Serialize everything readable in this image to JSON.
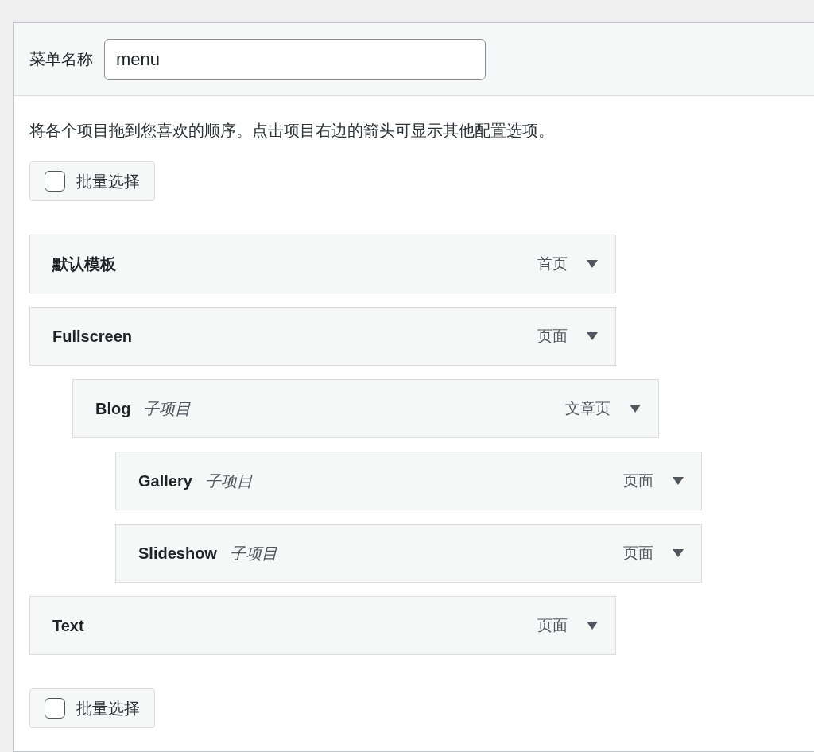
{
  "menu_name": {
    "label": "菜单名称",
    "value": "menu"
  },
  "instructions": "将各个项目拖到您喜欢的顺序。点击项目右边的箭头可显示其他配置选项。",
  "bulk_select_top": {
    "label": "批量选择",
    "checked": false
  },
  "menu_items": [
    {
      "title": "默认模板",
      "type": "首页"
    },
    {
      "title": "Fullscreen",
      "type": "页面",
      "children": [
        {
          "title": "Blog",
          "subtitle": "子项目",
          "type": "文章页",
          "children": [
            {
              "title": "Gallery",
              "subtitle": "子项目",
              "type": "页面"
            },
            {
              "title": "Slideshow",
              "subtitle": "子项目",
              "type": "页面"
            }
          ]
        }
      ]
    },
    {
      "title": "Text",
      "type": "页面"
    }
  ],
  "bulk_select_bottom": {
    "label": "批量选择",
    "checked": false
  }
}
